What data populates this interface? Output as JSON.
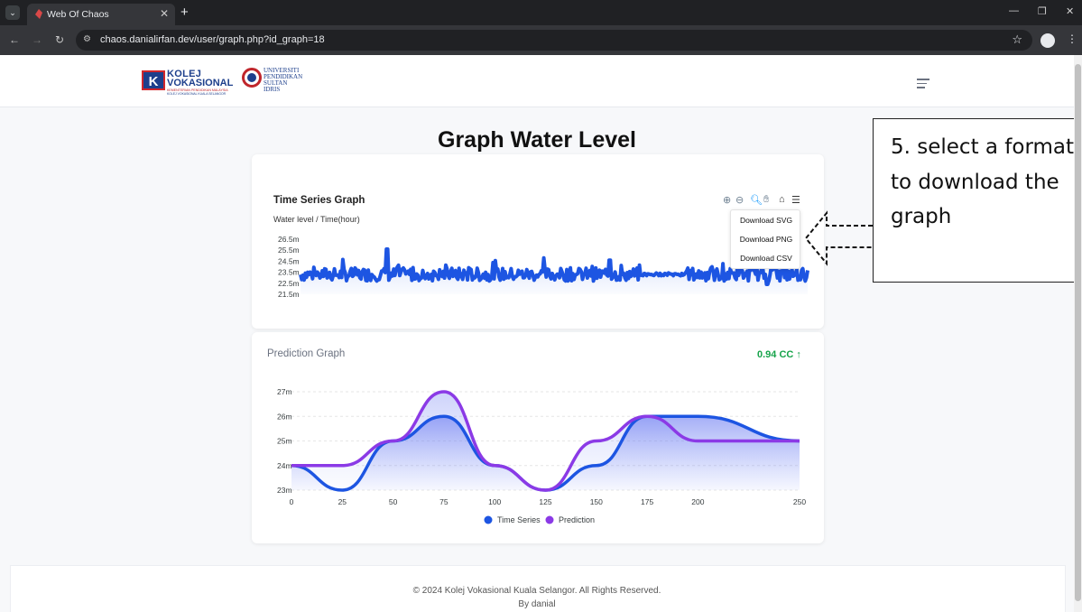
{
  "browser": {
    "tab_title": "Web Of Chaos",
    "url": "chaos.danialirfan.dev/user/graph.php?id_graph=18"
  },
  "header": {
    "logo1": {
      "line1": "KOLEJ",
      "line2": "VOKASIONAL",
      "line3": "KEMENTERIAN PENDIDIKAN MALAYSIA",
      "line4": "KOLEJ VOKASIONAL KUALA SELANGOR"
    },
    "logo2": {
      "line1": "UNIVERSITI",
      "line2": "PENDIDIKAN",
      "line3": "SULTAN IDRIS"
    }
  },
  "page_title": "Graph Water Level",
  "timeseries": {
    "title": "Time Series Graph",
    "subtitle": "Water level / Time(hour)",
    "menu": [
      "Download SVG",
      "Download PNG",
      "Download CSV"
    ]
  },
  "prediction": {
    "title": "Prediction Graph",
    "cc": "0.94 CC ↑"
  },
  "chart_data": [
    {
      "type": "line",
      "title": "Time Series Graph",
      "subtitle": "Water level / Time(hour)",
      "yticks": [
        "26.5m",
        "25.5m",
        "24.5m",
        "23.5m",
        "22.5m",
        "21.5m"
      ],
      "ylim": [
        21.5,
        26.5
      ],
      "series": [
        {
          "color": "#1d55e2",
          "baseline": 23.3,
          "min": 22.4,
          "max": 25.6,
          "spikes": [
            {
              "x": 0.17,
              "y": 25.6
            },
            {
              "x": 0.48,
              "y": 24.8
            },
            {
              "x": 0.61,
              "y": 24.6
            },
            {
              "x": 0.92,
              "y": 22.4
            }
          ]
        }
      ]
    },
    {
      "type": "area",
      "title": "Prediction Graph",
      "x": [
        0,
        25,
        50,
        75,
        100,
        125,
        150,
        175,
        200,
        250
      ],
      "ylim": [
        23,
        27
      ],
      "yticks": [
        "27m",
        "26m",
        "25m",
        "24m",
        "23m"
      ],
      "xticks": [
        "0",
        "25",
        "50",
        "75",
        "100",
        "125",
        "150",
        "175",
        "200",
        "250"
      ],
      "series": [
        {
          "name": "Time Series",
          "color": "#1d55e2",
          "values": [
            24,
            23,
            25,
            26,
            24,
            23,
            24,
            26,
            26,
            25
          ]
        },
        {
          "name": "Prediction",
          "color": "#8b3ae6",
          "values": [
            24,
            24,
            25,
            27,
            24,
            23,
            25,
            26,
            25,
            25
          ]
        }
      ],
      "legend": "bottom"
    }
  ],
  "annotation": {
    "text": "5. select a format to download the graph"
  },
  "footer": {
    "copyright": "© 2024 Kolej Vokasional Kuala Selangor. All Rights Reserved.",
    "by": "By danial"
  }
}
